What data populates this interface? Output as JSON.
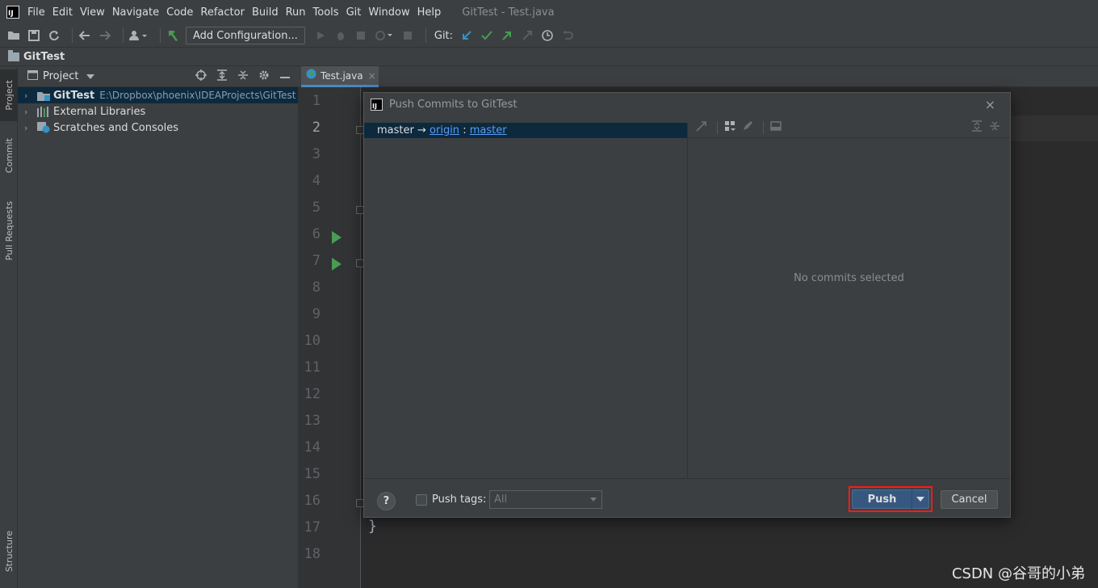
{
  "menubar": {
    "items": [
      "File",
      "Edit",
      "View",
      "Navigate",
      "Code",
      "Refactor",
      "Build",
      "Run",
      "Tools",
      "Git",
      "Window",
      "Help"
    ],
    "window_title": "GitTest - Test.java"
  },
  "toolbar": {
    "add_configuration_label": "Add Configuration...",
    "git_label": "Git:",
    "icons": [
      "open-folder-icon",
      "save-icon",
      "sync-icon",
      "back-icon",
      "forward-icon",
      "user-icon",
      "build-hammer-icon",
      "run-icon",
      "debug-icon",
      "coverage-icon",
      "profile-icon",
      "stop-icon",
      "git-update-icon",
      "git-commit-icon",
      "git-push-icon",
      "git-compare-icon",
      "history-icon",
      "rollback-icon"
    ]
  },
  "navbar": {
    "project_name": "GitTest"
  },
  "left_strip": {
    "tabs": [
      "Project",
      "Commit",
      "Pull Requests",
      "Structure"
    ]
  },
  "project_panel": {
    "title": "Project",
    "tree": [
      {
        "name": "GitTest",
        "path": "E:\\Dropbox\\phoenix\\IDEAProjects\\GitTest",
        "selected": true
      },
      {
        "name": "External Libraries",
        "path": "",
        "selected": false
      },
      {
        "name": "Scratches and Consoles",
        "path": "",
        "selected": false
      }
    ]
  },
  "editor": {
    "tab_label": "Test.java",
    "tab_close": "×",
    "current_line": 2,
    "line_numbers": [
      "1",
      "2",
      "3",
      "4",
      "5",
      "6",
      "7",
      "8",
      "9",
      "10",
      "11",
      "12",
      "13",
      "14",
      "15",
      "16",
      "17",
      "18"
    ],
    "run_marker_lines": [
      6,
      7
    ],
    "closing_brace": "}"
  },
  "dialog": {
    "title": "Push Commits to GitTest",
    "close": "×",
    "branch": {
      "local": "master",
      "arrow": "→",
      "remote": "origin",
      "separator": ":",
      "remote_branch": "master"
    },
    "no_commits_text": "No commits selected",
    "help_label": "?",
    "push_tags_label": "Push tags:",
    "push_tags_value": "All",
    "push_label": "Push",
    "cancel_label": "Cancel"
  },
  "colors": {
    "menubar_bg": "#3c3f41",
    "editor_bg": "#2b2b2b",
    "selection_bg": "#0d293e",
    "push_button_bg": "#365880",
    "highlight_border": "#ff1a1a",
    "link": "#589df6"
  },
  "watermark": "CSDN @谷哥的小弟"
}
